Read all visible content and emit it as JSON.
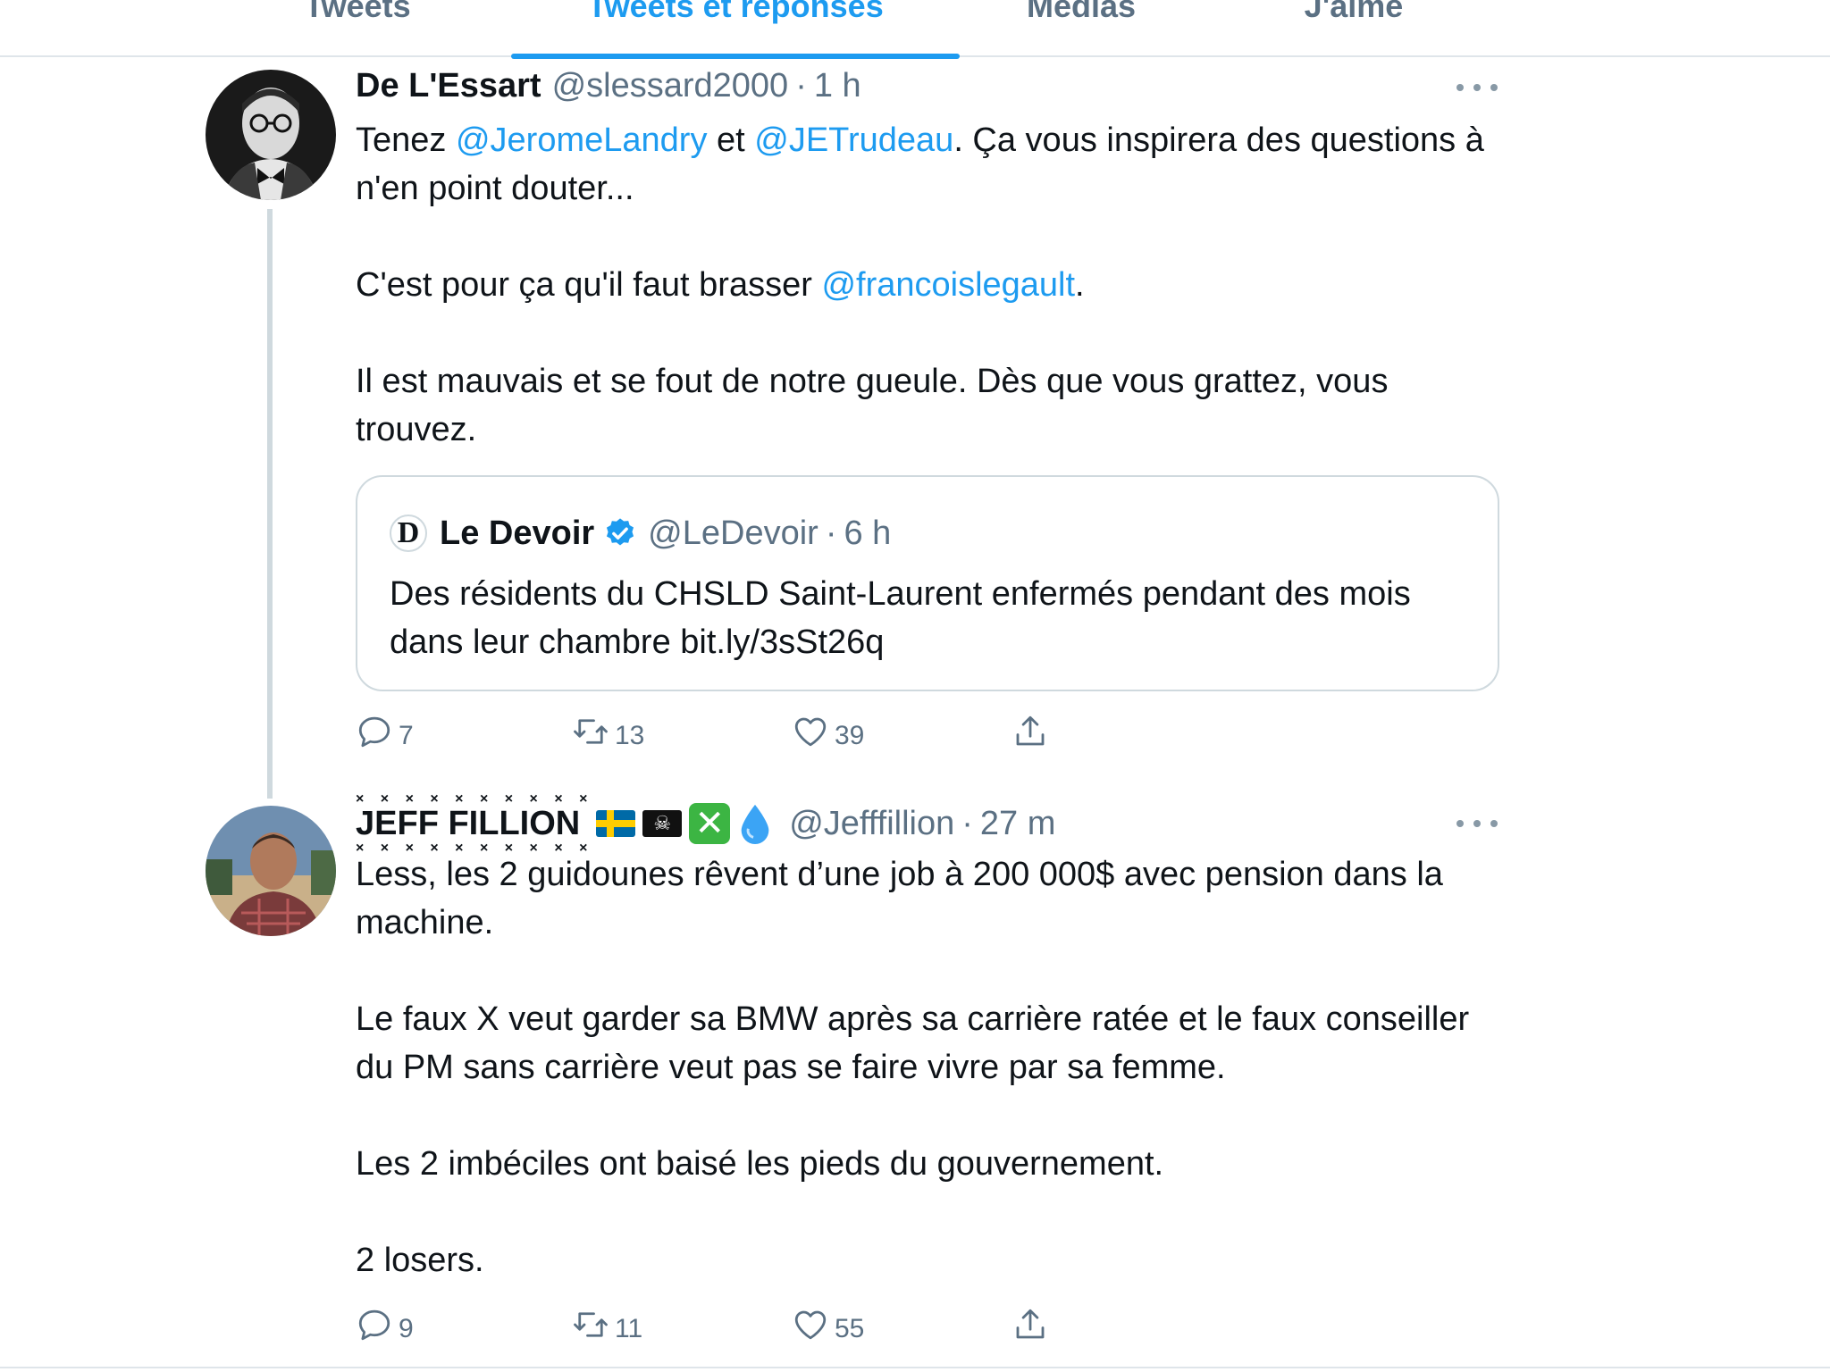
{
  "tabs": [
    {
      "label": "Tweets",
      "active": false
    },
    {
      "label": "Tweets et réponses",
      "active": true
    },
    {
      "label": "Médias",
      "active": false
    },
    {
      "label": "J'aime",
      "active": false
    }
  ],
  "tweet1": {
    "name": "De L'Essart",
    "handle": "@slessard2000",
    "separator": "·",
    "time": "1 h",
    "text": {
      "l1_a": "Tenez ",
      "l1_m1": "@JeromeLandry",
      "l1_b": " et ",
      "l1_m2": "@JETrudeau",
      "l1_c": ". Ça vous inspirera des questions à n'en point douter...",
      "l2_a": "C'est pour ça qu'il faut brasser ",
      "l2_m": "@francoislegault",
      "l2_b": ".",
      "l3": "Il est mauvais et se fout de notre gueule. Dès que vous grattez, vous trouvez."
    },
    "quote": {
      "logo": "D",
      "name": "Le Devoir",
      "handle": "@LeDevoir",
      "separator": "·",
      "time": "6 h",
      "text": "Des résidents du CHSLD Saint-Laurent enfermés pendant des mois dans leur chambre bit.ly/3sSt26q"
    },
    "actions": {
      "replies": "7",
      "retweets": "13",
      "likes": "39"
    }
  },
  "tweet2": {
    "name": "JEFF FILLION",
    "name_deco": "× × × ×   × × × × × ×",
    "emojis": [
      "flag-sweden",
      "pirate-flag",
      "cross-mark-button",
      "droplet"
    ],
    "handle": "@Jefffillion",
    "separator": "·",
    "time": "27 m",
    "text": {
      "p1": "Less, les 2 guidounes rêvent d’une job à 200 000$ avec pension dans la machine.",
      "p2": "Le faux X veut garder sa BMW après sa carrière ratée et le faux conseiller du PM sans carrière veut pas se faire vivre par sa femme.",
      "p3": "Les 2 imbéciles ont baisé les pieds du gouvernement.",
      "p4": "2 losers."
    },
    "actions": {
      "replies": "9",
      "retweets": "11",
      "likes": "55"
    }
  },
  "colors": {
    "accent": "#1d9bf0",
    "muted": "#5b7083",
    "text": "#0f1419",
    "border": "#cfd9de"
  }
}
